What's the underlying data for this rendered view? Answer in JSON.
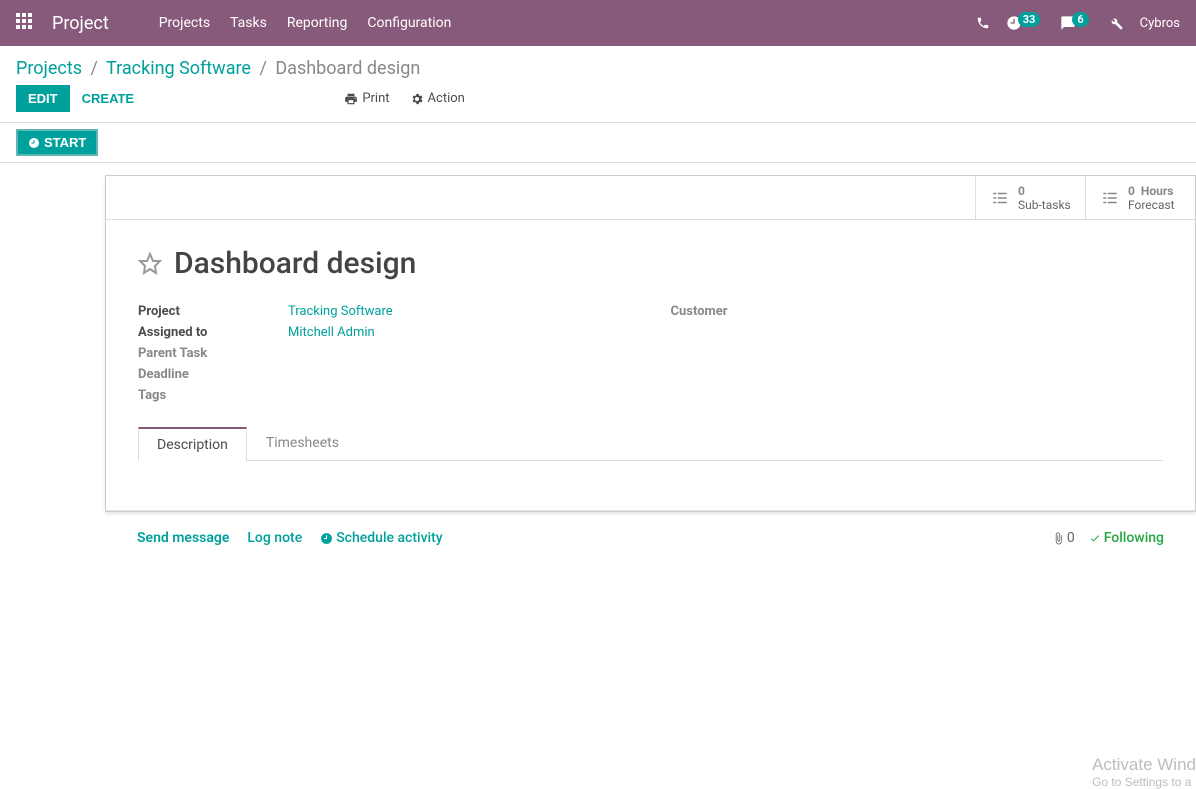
{
  "header": {
    "brand": "Project",
    "nav": [
      "Projects",
      "Tasks",
      "Reporting",
      "Configuration"
    ],
    "timer_badge": "33",
    "chat_badge": "6",
    "user": "Cybros"
  },
  "breadcrumb": {
    "level1": "Projects",
    "level2": "Tracking Software",
    "level3": "Dashboard design"
  },
  "cp": {
    "edit": "EDIT",
    "create": "CREATE",
    "print": "Print",
    "action": "Action",
    "start": "START"
  },
  "stats": {
    "subtasks_count": "0",
    "subtasks_label": "Sub-tasks",
    "forecast_count": "0",
    "forecast_unit": "Hours",
    "forecast_label": "Forecast"
  },
  "record": {
    "title": "Dashboard design",
    "labels": {
      "project": "Project",
      "assigned_to": "Assigned to",
      "parent_task": "Parent Task",
      "deadline": "Deadline",
      "tags": "Tags",
      "customer": "Customer"
    },
    "project_value": "Tracking Software",
    "assigned_to_value": "Mitchell Admin"
  },
  "tabs": {
    "description": "Description",
    "timesheets": "Timesheets"
  },
  "chatter": {
    "send": "Send message",
    "log": "Log note",
    "schedule": "Schedule activity",
    "attach_count": "0",
    "following": "Following"
  },
  "watermark": {
    "line1": "Activate Wind",
    "line2": "Go to Settings to a"
  }
}
